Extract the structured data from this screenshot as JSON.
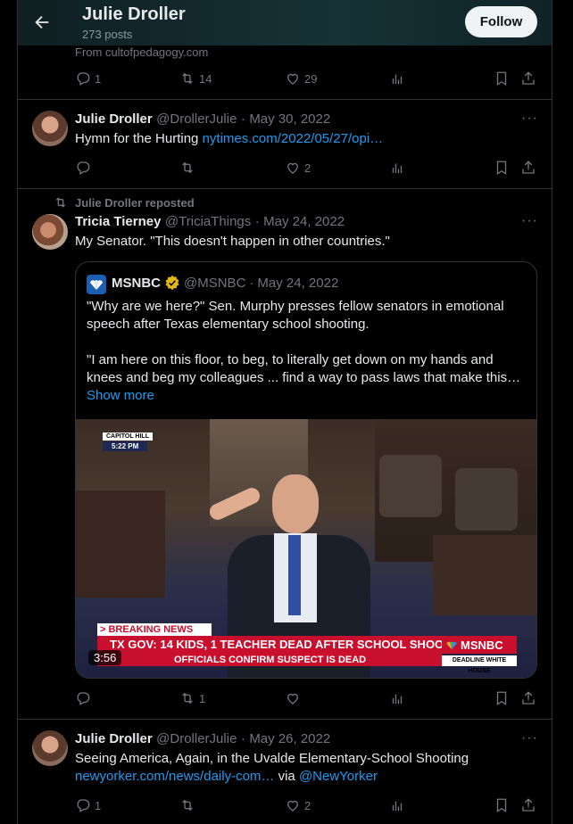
{
  "header": {
    "name": "Julie Droller",
    "posts": "273 posts",
    "follow_label": "Follow"
  },
  "tweet0": {
    "source": "From cultofpedagogy.com",
    "reply_count": "1",
    "retweet_count": "14",
    "like_count": "29"
  },
  "tweet1": {
    "name": "Julie Droller",
    "handle": "@DrollerJulie",
    "date": "May 30, 2022",
    "text": "Hymn for the Hurting",
    "link": "nytimes.com/2022/05/27/opi…",
    "like_count": "2"
  },
  "tweet2": {
    "repost_label": "Julie Droller reposted",
    "name": "Tricia Tierney",
    "handle": "@TriciaThings",
    "date": "May 24, 2022",
    "text": "My Senator. \"This doesn't happen in other countries.\"",
    "quote": {
      "name": "MSNBC",
      "handle": "@MSNBC",
      "date": "May 24, 2022",
      "para1_line1": "\"Why are we here?\" Sen. Murphy presses fellow senators in emotional",
      "para1_line2": "speech after Texas elementary school shooting.",
      "para2_line1": "\"I am here on this floor, to beg, to literally get down on my hands and",
      "para2_line2": "knees and beg my colleagues ... find a way to pass laws that make this…",
      "show_more": "Show more",
      "video": {
        "capitol_label": "CAPITOL HILL",
        "time": "5:22 PM",
        "breaking": "> BREAKING NEWS",
        "headline": "TX GOV: 14 KIDS, 1 TEACHER DEAD AFTER SCHOOL SHOOTING",
        "subhead": "OFFICIALS CONFIRM SUSPECT IS DEAD",
        "network": "MSNBC",
        "show": "DEADLINE  WHITE HOUSE",
        "duration": "3:56"
      }
    },
    "retweet_count": "1"
  },
  "tweet3": {
    "name": "Julie Droller",
    "handle": "@DrollerJulie",
    "date": "May 26, 2022",
    "text": "Seeing America, Again, in the Uvalde Elementary-School Shooting",
    "link": "newyorker.com/news/daily-com…",
    "via": "via",
    "mention": "@NewYorker",
    "reply_count": "1",
    "like_count": "2"
  },
  "colors": {
    "accent": "#1d9bf0",
    "muted": "#71767b",
    "border": "#2f3336",
    "msnbc_red": "#c8102e"
  }
}
